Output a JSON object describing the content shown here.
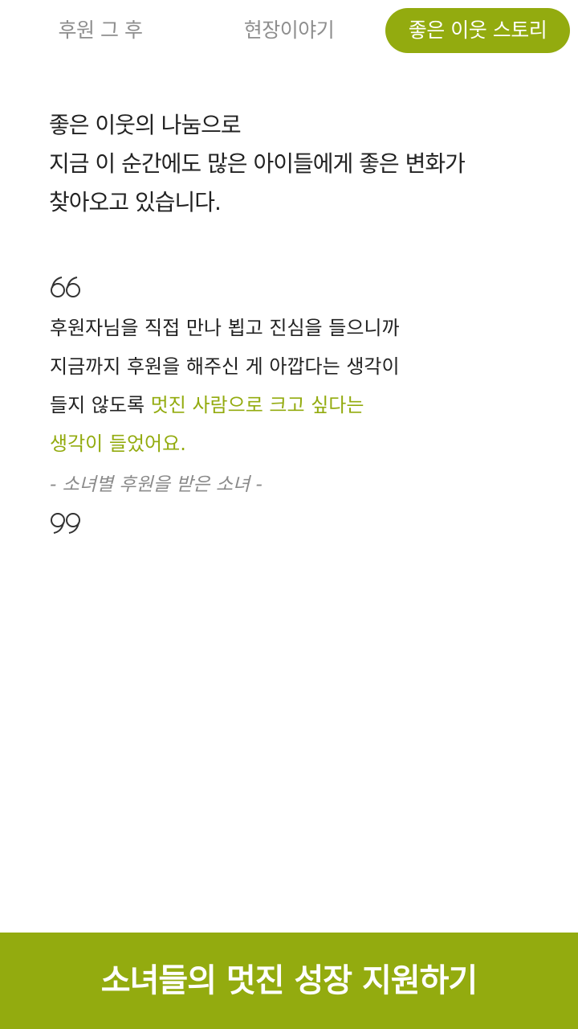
{
  "tabs": [
    {
      "label": "후원 그 후",
      "active": false
    },
    {
      "label": "현장이야기",
      "active": false
    },
    {
      "label": "좋은 이웃 스토리",
      "active": true
    }
  ],
  "intro": {
    "lines": [
      "좋은 이웃의 나눔으로",
      "지금 이 순간에도 많은 아이들에게 좋은 변화가",
      "찾아오고 있습니다."
    ]
  },
  "quote": {
    "open_icon": "open-quote-icon",
    "close_icon": "close-quote-icon",
    "line1": "후원자님을 직접 만나 뵙고 진심을 들으니까",
    "line2": "지금까지 후원을 해주신 게 아깝다는 생각이",
    "line3_plain": "들지 않도록 ",
    "line3_highlight": "멋진 사람으로 크고 싶다는",
    "line4_highlight": "생각이 들었어요.",
    "attribution": "- 소녀별 후원을 받은 소녀 -"
  },
  "cta": {
    "label": "소녀들의 멋진 성장 지원하기"
  },
  "colors": {
    "accent": "#93ab0f",
    "text": "#222222",
    "muted": "#8e8e8e"
  }
}
